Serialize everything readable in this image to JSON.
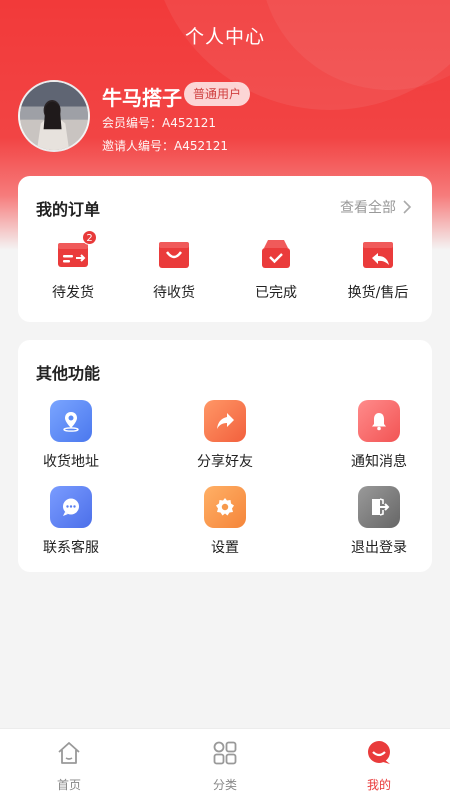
{
  "header": {
    "title": "个人中心"
  },
  "user": {
    "name": "牛马搭子",
    "badge": "普通用户",
    "member_id_line": "会员编号：A452121",
    "inviter_id_line": "邀请人编号：A452121"
  },
  "orders": {
    "title": "我的订单",
    "view_all": "查看全部",
    "items": [
      {
        "label": "待发货",
        "icon": "truck-icon",
        "badge": "2"
      },
      {
        "label": "待收货",
        "icon": "shopping-bag-icon"
      },
      {
        "label": "已完成",
        "icon": "box-check-icon"
      },
      {
        "label": "换货/售后",
        "icon": "return-icon"
      }
    ]
  },
  "functions": {
    "title": "其他功能",
    "items": [
      {
        "label": "收货地址",
        "icon": "location-pin-icon",
        "color": "#5b8cf7"
      },
      {
        "label": "分享好友",
        "icon": "share-arrow-icon",
        "color": "#f6774f"
      },
      {
        "label": "通知消息",
        "icon": "bell-icon",
        "color": "#f66a6a"
      },
      {
        "label": "联系客服",
        "icon": "chat-bubble-icon",
        "color": "#5b80f3"
      },
      {
        "label": "设置",
        "icon": "gear-icon",
        "color": "#f79a4c"
      },
      {
        "label": "退出登录",
        "icon": "logout-door-icon",
        "color": "#7c7c7c"
      }
    ]
  },
  "tabbar": {
    "items": [
      {
        "label": "首页",
        "icon": "home-icon"
      },
      {
        "label": "分类",
        "icon": "category-grid-icon"
      },
      {
        "label": "我的",
        "icon": "profile-chat-icon",
        "active": true
      }
    ]
  },
  "colors": {
    "brand": "#e93b3b",
    "background": "#f4f4f4"
  }
}
